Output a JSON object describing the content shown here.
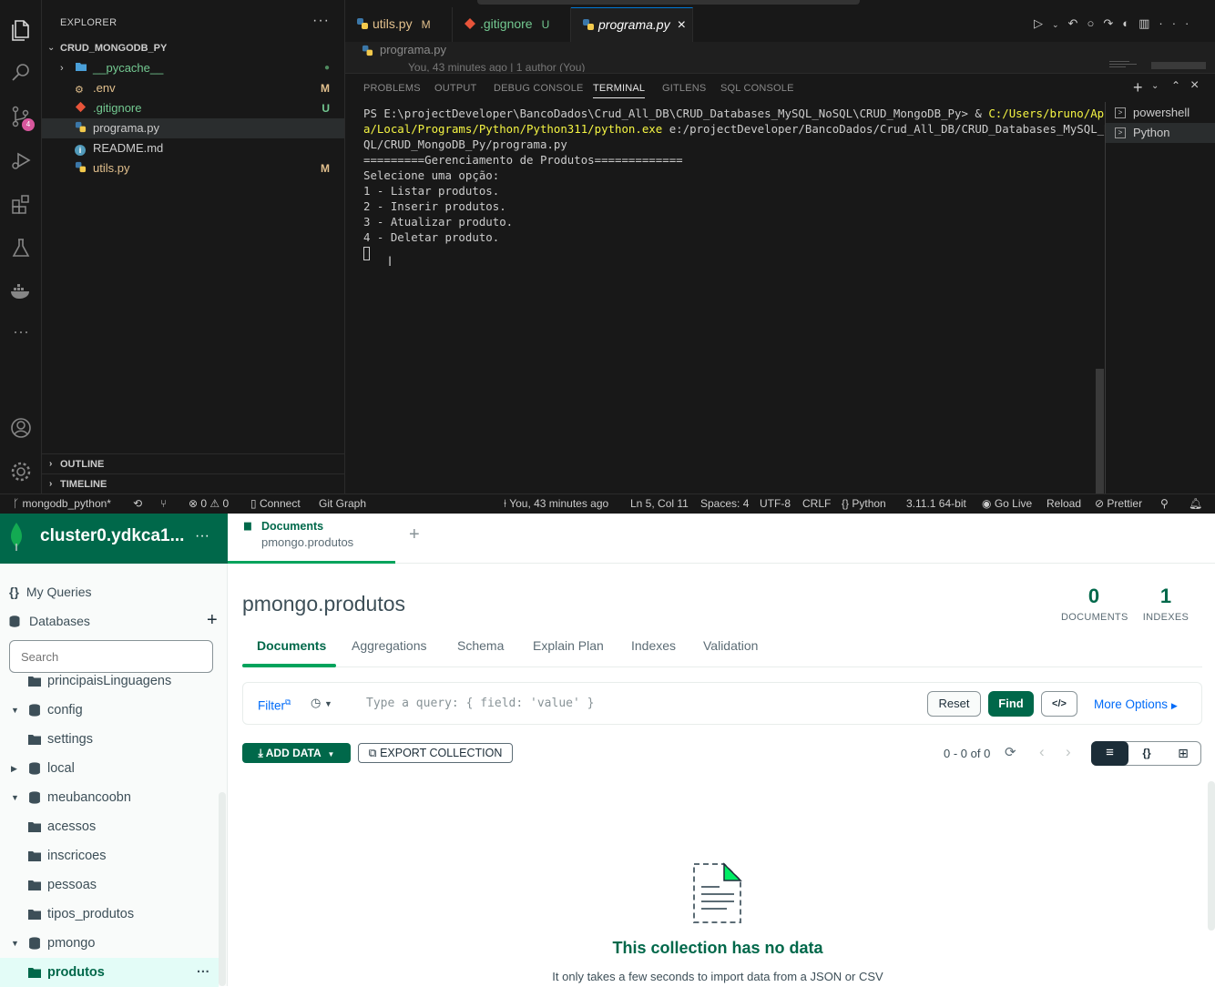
{
  "vscode": {
    "explorer": {
      "title": "EXPLORER",
      "folder": "CRUD_MONGODB_PY",
      "files": [
        {
          "name": "__pycache__",
          "badge": "●",
          "color": "#73c991",
          "badge_color": "#4f8a5f",
          "icon": "folder-icon"
        },
        {
          "name": ".env",
          "badge": "M",
          "color": "#e2c08d",
          "badge_color": "#e2c08d",
          "icon": "settings-file-icon"
        },
        {
          "name": ".gitignore",
          "badge": "U",
          "color": "#73c991",
          "badge_color": "#73c991",
          "icon": "git-icon"
        },
        {
          "name": "programa.py",
          "badge": "",
          "color": "#cccccc",
          "badge_color": "#cccccc",
          "icon": "python-icon"
        },
        {
          "name": "README.md",
          "badge": "",
          "color": "#cccccc",
          "badge_color": "#cccccc",
          "icon": "info-icon"
        },
        {
          "name": "utils.py",
          "badge": "M",
          "color": "#e2c08d",
          "badge_color": "#e2c08d",
          "icon": "python-icon"
        }
      ],
      "outline": "OUTLINE",
      "timeline": "TIMELINE"
    },
    "tabs": [
      {
        "name": "utils.py",
        "state": "M",
        "color": "#e2c08d"
      },
      {
        "name": ".gitignore",
        "state": "U",
        "color": "#73c991"
      },
      {
        "name": "programa.py",
        "state": "×",
        "color": "#ffffff"
      }
    ],
    "breadcrumb": "programa.py",
    "blame": "You, 43 minutes ago | 1 author (You)",
    "panel_tabs": [
      "PROBLEMS",
      "OUTPUT",
      "DEBUG CONSOLE",
      "TERMINAL",
      "GITLENS",
      "SQL CONSOLE"
    ],
    "active_panel_tab": "TERMINAL",
    "terminal": {
      "prompt": "PS E:\\projectDeveloper\\BancoDados\\Crud_All_DB\\CRUD_Databases_MySQL_NoSQL\\CRUD_MongoDB_Py> & ",
      "exe_1": "C:/Users/bruno/AppDat",
      "exe_2": "a/Local/Programs/Python/Python311/python.exe",
      "arg_1": " e:/projectDeveloper/BancoDados/Crud_All_DB/CRUD_Databases_MySQL_NoS",
      "arg_2": "QL/CRUD_MongoDB_Py/programa.py",
      "lines": [
        "=========Gerenciamento de Produtos=============",
        "Selecione uma opção:",
        "1 - Listar produtos.",
        "2 - Inserir produtos.",
        "3 - Atualizar produto.",
        "4 - Deletar produto."
      ]
    },
    "terminal_list": [
      "powershell",
      "Python"
    ],
    "source_control_badge": "4",
    "statusbar": {
      "branch": "mongodb_python*",
      "errors": "0",
      "warnings": "0",
      "connect": "Connect",
      "git_graph": "Git Graph",
      "blame": "You, 43 minutes ago",
      "position": "Ln 5, Col 11",
      "spaces": "Spaces: 4",
      "encoding": "UTF-8",
      "eol": "CRLF",
      "language": "Python",
      "interpreter": "3.11.1 64-bit",
      "go_live": "Go Live",
      "reload": "Reload",
      "prettier": "Prettier"
    }
  },
  "compass": {
    "cluster": "cluster0.ydkca1...",
    "my_queries": "My Queries",
    "databases": "Databases",
    "search_placeholder": "Search",
    "tree": [
      {
        "name": "principaisLinguagens",
        "type": "collection",
        "caret": ""
      },
      {
        "name": "config",
        "type": "db",
        "caret": "▼"
      },
      {
        "name": "settings",
        "type": "collection",
        "caret": ""
      },
      {
        "name": "local",
        "type": "db",
        "caret": "▶"
      },
      {
        "name": "meubancoobn",
        "type": "db",
        "caret": "▼"
      },
      {
        "name": "acessos",
        "type": "collection",
        "caret": ""
      },
      {
        "name": "inscricoes",
        "type": "collection",
        "caret": ""
      },
      {
        "name": "pessoas",
        "type": "collection",
        "caret": ""
      },
      {
        "name": "tipos_produtos",
        "type": "collection",
        "caret": ""
      },
      {
        "name": "pmongo",
        "type": "db",
        "caret": "▼"
      },
      {
        "name": "produtos",
        "type": "collection",
        "caret": "",
        "active": true
      }
    ],
    "tab": {
      "title": "Documents",
      "subtitle": "pmongo.produtos"
    },
    "collection_title": "pmongo.produtos",
    "stats": {
      "documents": "0",
      "documents_label": "DOCUMENTS",
      "indexes": "1",
      "indexes_label": "INDEXES"
    },
    "subtabs": [
      "Documents",
      "Aggregations",
      "Schema",
      "Explain Plan",
      "Indexes",
      "Validation"
    ],
    "filter_label": "Filter",
    "query_placeholder": "Type a query: { field: 'value' }",
    "reset": "Reset",
    "find": "Find",
    "more_options": "More Options",
    "add_data": "ADD DATA",
    "export": "EXPORT COLLECTION",
    "pagination": "0 - 0 of 0",
    "empty_title": "This collection has no data",
    "empty_sub": "It only takes a few seconds to import data from a JSON or CSV"
  }
}
